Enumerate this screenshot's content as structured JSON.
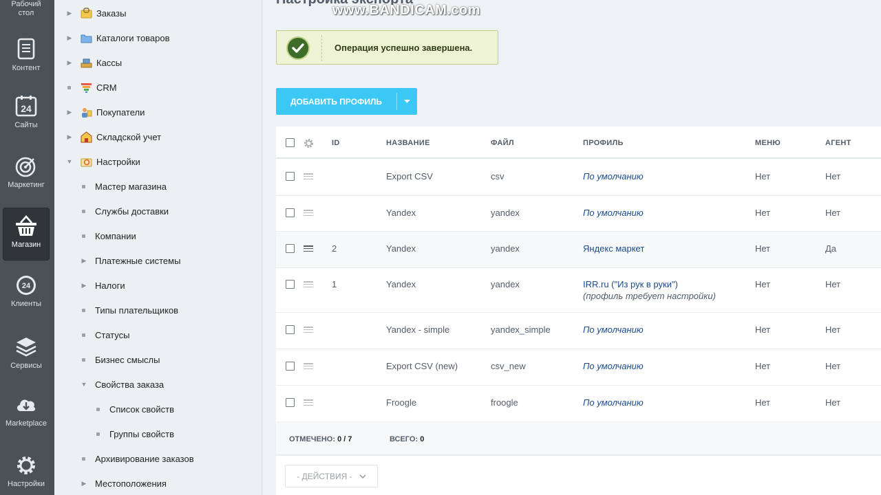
{
  "rail": {
    "items": [
      {
        "label": "Рабочий стол",
        "icon": "desktop-icon"
      },
      {
        "label": "Контент",
        "icon": "document-icon"
      },
      {
        "label": "Сайты",
        "icon": "calendar-24-icon"
      },
      {
        "label": "Маркетинг",
        "icon": "target-icon"
      },
      {
        "label": "Магазин",
        "icon": "basket-icon"
      },
      {
        "label": "Клиенты",
        "icon": "clients-24-icon"
      },
      {
        "label": "Сервисы",
        "icon": "layers-icon"
      },
      {
        "label": "Marketplace",
        "icon": "cloud-download-icon"
      },
      {
        "label": "Настройки",
        "icon": "gear-icon"
      }
    ]
  },
  "tree": {
    "items": [
      {
        "label": "Заказы"
      },
      {
        "label": "Каталоги товаров"
      },
      {
        "label": "Кассы"
      },
      {
        "label": "CRM"
      },
      {
        "label": "Покупатели"
      },
      {
        "label": "Складской учет"
      },
      {
        "label": "Настройки"
      },
      {
        "label": "Мастер магазина"
      },
      {
        "label": "Службы доставки"
      },
      {
        "label": "Компании"
      },
      {
        "label": "Платежные системы"
      },
      {
        "label": "Налоги"
      },
      {
        "label": "Типы плательщиков"
      },
      {
        "label": "Статусы"
      },
      {
        "label": "Бизнес смыслы"
      },
      {
        "label": "Свойства заказа"
      },
      {
        "label": "Список свойств"
      },
      {
        "label": "Группы свойств"
      },
      {
        "label": "Архивирование заказов"
      },
      {
        "label": "Местоположения"
      }
    ]
  },
  "page": {
    "title": "Настройка экспорта",
    "watermark": "www.BANDICAM.com"
  },
  "notice": {
    "message": "Операция успешно завершена."
  },
  "toolbar": {
    "add_profile_label": "ДОБАВИТЬ ПРОФИЛЬ"
  },
  "grid": {
    "headers": {
      "id": "ID",
      "name": "НАЗВАНИЕ",
      "file": "ФАЙЛ",
      "profile": "ПРОФИЛЬ",
      "menu": "МЕНЮ",
      "agent": "АГЕНТ"
    },
    "rows": [
      {
        "id": "",
        "name": "Export CSV",
        "file": "csv",
        "profile": "По умолчанию",
        "profile_note": "",
        "menu": "Нет",
        "agent": "Нет"
      },
      {
        "id": "",
        "name": "Yandex",
        "file": "yandex",
        "profile": "По умолчанию",
        "profile_note": "",
        "menu": "Нет",
        "agent": "Нет"
      },
      {
        "id": "2",
        "name": "Yandex",
        "file": "yandex",
        "profile": "Яндекс маркет",
        "profile_note": "",
        "menu": "Нет",
        "agent": "Да"
      },
      {
        "id": "1",
        "name": "Yandex",
        "file": "yandex",
        "profile": "IRR.ru (\"Из рук в руки\")",
        "profile_note": "(профиль требует настройки)",
        "menu": "Нет",
        "agent": "Нет"
      },
      {
        "id": "",
        "name": "Yandex - simple",
        "file": "yandex_simple",
        "profile": "По умолчанию",
        "profile_note": "",
        "menu": "Нет",
        "agent": "Нет"
      },
      {
        "id": "",
        "name": "Export CSV (new)",
        "file": "csv_new",
        "profile": "По умолчанию",
        "profile_note": "",
        "menu": "Нет",
        "agent": "Нет"
      },
      {
        "id": "",
        "name": "Froogle",
        "file": "froogle",
        "profile": "По умолчанию",
        "profile_note": "",
        "menu": "Нет",
        "agent": "Нет"
      }
    ],
    "footer": {
      "selected_label": "ОТМЕЧЕНО:",
      "selected_value": "0 / 7",
      "total_label": "ВСЕГО:",
      "total_value": "0"
    }
  },
  "actions": {
    "label": "- ДЕЙСТВИЯ -"
  },
  "colors": {
    "accent": "#3bc8f5",
    "rail": "#4b5257",
    "link": "#1a4b8f",
    "success": "#3e6d2a"
  }
}
